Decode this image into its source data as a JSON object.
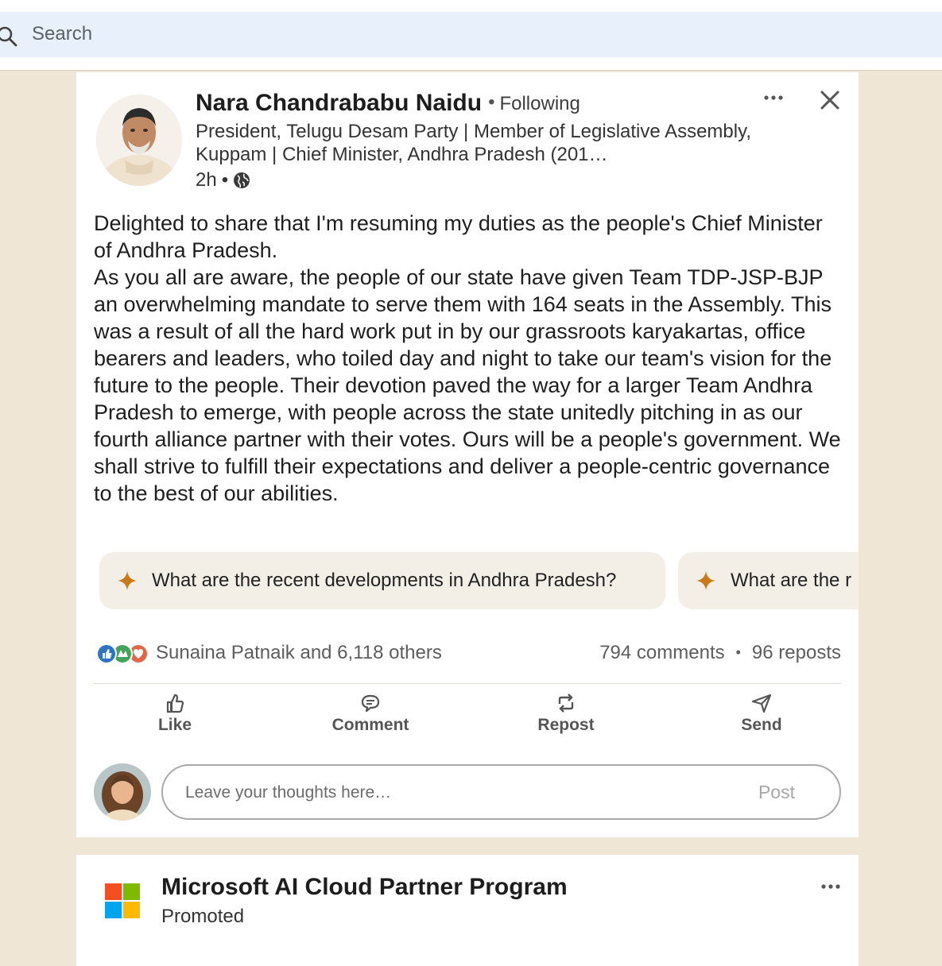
{
  "search": {
    "placeholder": "Search"
  },
  "post": {
    "author": {
      "name": "Nara Chandrababu Naidu",
      "follow_status": "Following",
      "headline": "President, Telugu Desam Party | Member of Legislative Assembly, Kuppam | Chief Minister, Andhra Pradesh (201…",
      "time": "2h",
      "separator": "•"
    },
    "body": [
      "Delighted to share that I'm resuming my duties as the people's Chief Minister of Andhra Pradesh.",
      "As you all are aware, the people of our state have given Team TDP-JSP-BJP an overwhelming mandate to serve them with 164 seats in the Assembly. This was a result of all the hard work put in by our grassroots karyakartas, office bearers and leaders, who toiled day and night to take our team's vision for the future to the people. Their devotion paved the way for a larger Team Andhra Pradesh to emerge, with people across the state unitedly pitching in as our fourth alliance partner with their votes. Ours will be a people's government. We shall strive to fulfill their expectations and deliver a people-centric governance to the best of our abilities."
    ],
    "suggestions": [
      "What are the recent developments in Andhra Pradesh?",
      "What are the r"
    ],
    "social": {
      "reactors": "Sunaina Patnaik and 6,118 others",
      "comments": "794 comments",
      "separator": "•",
      "reposts": "96 reposts"
    },
    "actions": {
      "like": "Like",
      "comment": "Comment",
      "repost": "Repost",
      "send": "Send"
    },
    "comment_box": {
      "placeholder": "Leave your thoughts here…",
      "post_label": "Post"
    }
  },
  "ad": {
    "name": "Microsoft AI Cloud Partner Program",
    "label": "Promoted"
  },
  "colors": {
    "page_bg": "#efe6d6",
    "search_bg": "#e7f0fb",
    "chip_bg": "#f4efe6",
    "sparkle": "#c87a1a",
    "ms_red": "#f25022",
    "ms_green": "#7fba00",
    "ms_blue": "#00a4ef",
    "ms_yellow": "#ffb900"
  },
  "icons": [
    "search-icon",
    "globe-icon",
    "more-icon",
    "close-icon",
    "sparkle-icon",
    "like-icon",
    "comment-icon",
    "repost-icon",
    "send-icon",
    "microsoft-logo"
  ]
}
